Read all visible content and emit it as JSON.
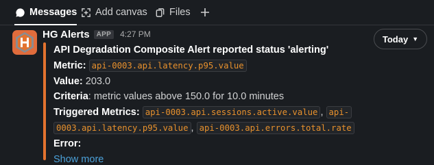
{
  "tabs": [
    {
      "label": "Messages",
      "icon": "message-bubble-icon",
      "active": true
    },
    {
      "label": "Add canvas",
      "icon": "canvas-icon",
      "active": false
    },
    {
      "label": "Files",
      "icon": "files-icon",
      "active": false
    }
  ],
  "message": {
    "sender": "HG Alerts",
    "badge": "APP",
    "time": "4:27 PM",
    "title": "API Degradation Composite Alert reported status 'alerting'",
    "metric_label": "Metric:",
    "metric_value": "api-0003.api.latency.p95.value",
    "value_label": "Value:",
    "value_value": "203.0",
    "criteria_label": "Criteria",
    "criteria_text": ": metric values above 150.0 for 10.0 minutes",
    "triggered_label": "Triggered Metrics:",
    "triggered_1": "api-0003.api.sessions.active.value",
    "triggered_2a": "api-",
    "triggered_2b": "0003.api.latency.p95.value",
    "triggered_3": "api-0003.api.errors.total.rate",
    "error_label": "Error:",
    "show_more": "Show more"
  },
  "date_pill": "Today",
  "colors": {
    "accent_bar": "#e3732f",
    "link": "#4ba0d8",
    "code": "#e8912d",
    "avatar": "#e06c3c"
  }
}
